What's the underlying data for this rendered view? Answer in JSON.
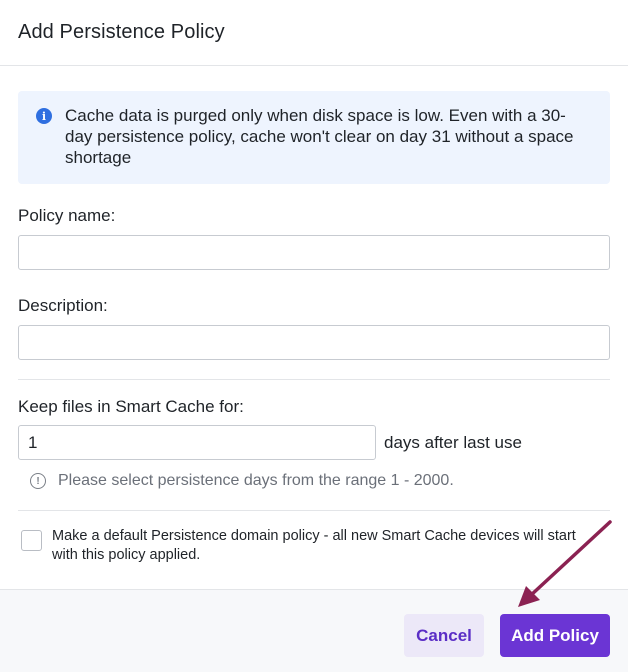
{
  "dialog": {
    "title": "Add Persistence Policy"
  },
  "info": {
    "icon": "info-icon",
    "message": "Cache data is purged only when disk space is low. Even with a 30-day persistence policy, cache won't clear on day 31 without a space shortage"
  },
  "fields": {
    "policy_name": {
      "label": "Policy name:",
      "value": "",
      "placeholder": ""
    },
    "description": {
      "label": "Description:",
      "value": "",
      "placeholder": ""
    },
    "keep_days": {
      "label": "Keep files in Smart Cache for:",
      "value": "1",
      "suffix": "days after last use",
      "hint_icon": "alert-circle-icon",
      "hint": "Please select persistence days from the range 1 - 2000."
    }
  },
  "default_policy": {
    "checked": false,
    "label": "Make a default Persistence domain policy - all new Smart Cache devices will start with this policy applied."
  },
  "footer": {
    "cancel_label": "Cancel",
    "submit_label": "Add Policy"
  },
  "colors": {
    "primary": "#6b35d4",
    "cancel_bg": "#ece8f8",
    "info_bg": "#eef4fe",
    "info_icon": "#2f6fe0",
    "annotation_arrow": "#8b2252"
  }
}
